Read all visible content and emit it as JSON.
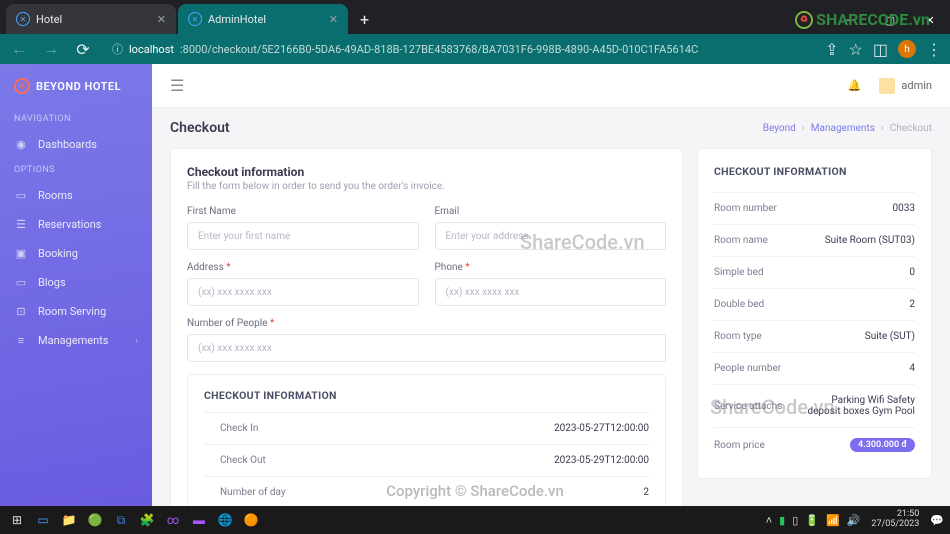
{
  "browser": {
    "tabs": [
      {
        "title": "Hotel",
        "active": false
      },
      {
        "title": "AdminHotel",
        "active": true
      }
    ],
    "url_host": "localhost",
    "url_path": ":8000/checkout/5E2166B0-5DA6-49AD-818B-127BE4583768/BA7031F6-998B-4890-A45D-010C1FA5614C",
    "user_initial": "h"
  },
  "brand": "BEYOND HOTEL",
  "sidebar": {
    "navigation_label": "NAVIGATION",
    "options_label": "OPTIONS",
    "dashboards": "Dashboards",
    "items": [
      {
        "icon": "▭",
        "label": "Rooms"
      },
      {
        "icon": "☰",
        "label": "Reservations"
      },
      {
        "icon": "▣",
        "label": "Booking"
      },
      {
        "icon": "▭",
        "label": "Blogs"
      },
      {
        "icon": "⊡",
        "label": "Room Serving"
      },
      {
        "icon": "≡",
        "label": "Managements",
        "chev": true
      }
    ]
  },
  "topbar": {
    "username": "admin"
  },
  "page": {
    "title": "Checkout",
    "breadcrumb": {
      "a": "Beyond",
      "b": "Managements",
      "c": "Checkout"
    }
  },
  "form": {
    "title": "Checkout information",
    "subtitle": "Fill the form below in order to send you the order's invoice.",
    "first_name_label": "First Name",
    "first_name_ph": "Enter your first name",
    "email_label": "Email",
    "email_ph": "Enter your address",
    "address_label": "Address",
    "address_ph": "(xx) xxx xxxx xxx",
    "phone_label": "Phone",
    "phone_ph": "(xx) xxx xxxx xxx",
    "people_label": "Number of People",
    "people_ph": "(xx) xxx xxxx xxx"
  },
  "checkout_sub": {
    "title": "CHECKOUT INFORMATION",
    "rows": [
      {
        "k": "Check In",
        "v": "2023-05-27T12:00:00"
      },
      {
        "k": "Check Out",
        "v": "2023-05-29T12:00:00"
      },
      {
        "k": "Number of day",
        "v": "2"
      }
    ]
  },
  "info": {
    "title": "CHECKOUT INFORMATION",
    "rows": [
      {
        "k": "Room number",
        "v": "0033"
      },
      {
        "k": "Room name",
        "v": "Suite Room (SUT03)"
      },
      {
        "k": "Simple bed",
        "v": "0"
      },
      {
        "k": "Double bed",
        "v": "2"
      },
      {
        "k": "Room type",
        "v": "Suite (SUT)"
      },
      {
        "k": "People number",
        "v": "4"
      },
      {
        "k": "Service attachs",
        "v": "Parking Wifi Safety deposit boxes Gym Pool"
      }
    ],
    "price_label": "Room price",
    "price_value": "4.300.000 đ"
  },
  "taskbar": {
    "time": "21:50",
    "date": "27/05/2023"
  },
  "watermarks": {
    "brand": "SHARECODE.vn",
    "text": "ShareCode.vn",
    "copyright": "Copyright © ShareCode.vn"
  }
}
